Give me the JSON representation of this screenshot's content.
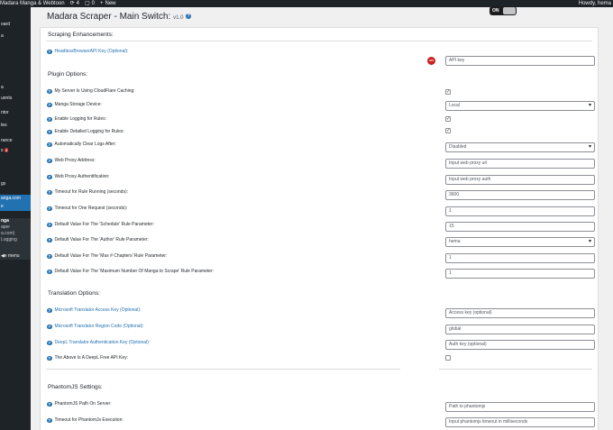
{
  "adminbar": {
    "site_name": "Madara Manga & Webtoon",
    "updates_count": "4",
    "comments_count": "0",
    "new_label": "New",
    "howdy": "Howdy, hema"
  },
  "sidebar": {
    "items": [
      "oard",
      "a",
      "a",
      "uents",
      "ntor",
      "tes",
      "rance",
      "s",
      "gs",
      "anga.com",
      "e"
    ],
    "badge": "4",
    "sub_items": [
      "nga",
      "aper",
      "a.com)",
      "Logging"
    ],
    "collapse": "e menu"
  },
  "page": {
    "title": "Madara Scraper - Main Switch:",
    "version": "v1.0",
    "toggle_on": "ON",
    "help": "?"
  },
  "sections": {
    "scraping": "Scraping Enhancements:",
    "plugin": "Plugin Options:",
    "translation": "Translation Options:",
    "phantom": "PhantomJS Settings:"
  },
  "rows": {
    "headless_label": "HeadlessBrowserAPI Key (Optional):",
    "headless_placeholder": "API key",
    "api_badge": "API",
    "cloudflare_label": "My Server Is Using CloudFlare Caching:",
    "storage_label": "Manga Storage Device:",
    "storage_value": "Local",
    "logging_label": "Enable Logging for Rules:",
    "detailed_logging_label": "Enable Detailed Logging for Rules:",
    "clear_logs_label": "Automatically Clear Logs After:",
    "clear_logs_value": "Disabled",
    "proxy_label": "Web Proxy Address:",
    "proxy_placeholder": "Input web proxy url",
    "proxy_auth_label": "Web Proxy Authentification:",
    "proxy_auth_placeholder": "Input web proxy auth",
    "timeout_rule_label": "Timeout for Rule Running (seconds):",
    "timeout_rule_value": "3600",
    "timeout_request_label": "Timeout for One Request (seconds):",
    "timeout_request_value": "1",
    "schedule_label": "Default Value For The 'Schedule' Rule Parameter:",
    "schedule_value": "15",
    "author_label": "Default Value For The 'Author' Rule Parameter:",
    "author_value": "hema",
    "max_chapters_label": "Default Value For The 'Max # Chapters' Rule Parameter:",
    "max_chapters_value": "1",
    "max_manga_label": "Default Value For The 'Maximum Number Of Manga to Scrape' Rule Parameter:",
    "max_manga_value": "1",
    "ms_key_label": "Microsoft Translator Access Key (Optional):",
    "ms_key_placeholder": "Access key (optional)",
    "ms_region_label": "Microsoft Translator Region Code (Optional):",
    "ms_region_value": "global",
    "deepl_label": "DeepL Translator Authentication Key (Optional):",
    "deepl_placeholder": "Auth key (optional)",
    "deepl_free_label": "The Above Is A DeepL Free API Key:",
    "phantom_path_label": "PhantomJS Path On Server:",
    "phantom_path_placeholder": "Path to phantomjs",
    "phantom_timeout_label": "Timeout for PhantomJs Execution:",
    "phantom_timeout_placeholder": "Input phantomjs timeout in milliseconds"
  },
  "checks": {
    "cloudflare": "✓",
    "logging": "✓",
    "detailed_logging": "✓",
    "deepl_free": ""
  }
}
